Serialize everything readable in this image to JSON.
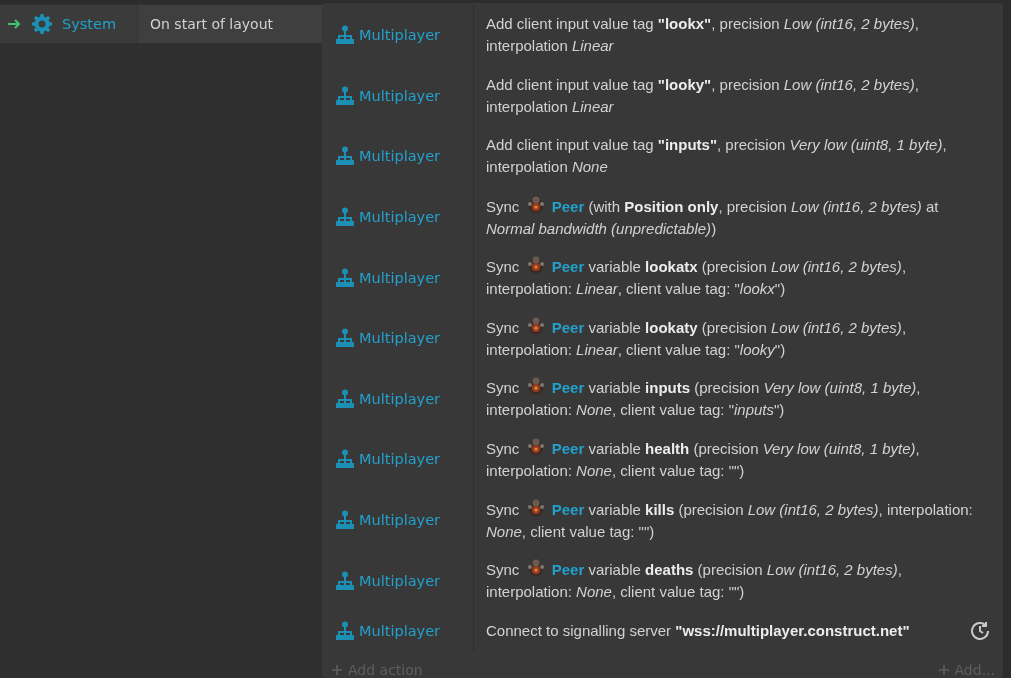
{
  "event": {
    "object": "System",
    "condition": "On start of layout"
  },
  "actions": [
    {
      "kind": "plain",
      "object": "Multiplayer",
      "async": false,
      "text": "Add client input value tag **\"lookx\"**, precision *Low (int16, 2 bytes)*, interpolation *Linear*"
    },
    {
      "kind": "plain",
      "object": "Multiplayer",
      "async": false,
      "text": "Add client input value tag **\"looky\"**, precision *Low (int16, 2 bytes)*, interpolation *Linear*"
    },
    {
      "kind": "plain",
      "object": "Multiplayer",
      "async": false,
      "text": "Add client input value tag **\"inputs\"**, precision *Very low (uint8, 1 byte)*, interpolation *None*"
    },
    {
      "kind": "sync",
      "object": "Multiplayer",
      "async": false,
      "verb": "Sync",
      "target": "Peer",
      "text": "(with **Position only**, precision *Low (int16, 2 bytes)* at *Normal bandwidth (unpredictable)*)"
    },
    {
      "kind": "sync",
      "object": "Multiplayer",
      "async": false,
      "verb": "Sync",
      "target": "Peer",
      "text": "variable **lookatx** (precision *Low (int16, 2 bytes)*, interpolation: *Linear*, client value tag: \"*lookx*\")"
    },
    {
      "kind": "sync",
      "object": "Multiplayer",
      "async": false,
      "verb": "Sync",
      "target": "Peer",
      "text": "variable **lookaty** (precision *Low (int16, 2 bytes)*, interpolation: *Linear*, client value tag: \"*looky*\")"
    },
    {
      "kind": "sync",
      "object": "Multiplayer",
      "async": false,
      "verb": "Sync",
      "target": "Peer",
      "text": "variable **inputs** (precision *Very low (uint8, 1 byte)*, interpolation: *None*, client value tag: \"*inputs*\")"
    },
    {
      "kind": "sync",
      "object": "Multiplayer",
      "async": false,
      "verb": "Sync",
      "target": "Peer",
      "text": "variable **health** (precision *Very low (uint8, 1 byte)*, interpolation: *None*, client value tag: \"\")"
    },
    {
      "kind": "sync",
      "object": "Multiplayer",
      "async": false,
      "verb": "Sync",
      "target": "Peer",
      "text": "variable **kills** (precision *Low (int16, 2 bytes)*, interpolation: *None*, client value tag: \"\")"
    },
    {
      "kind": "sync",
      "object": "Multiplayer",
      "async": false,
      "verb": "Sync",
      "target": "Peer",
      "text": "variable **deaths** (precision *Low (int16, 2 bytes)*, interpolation: *None*, client value tag: \"\")"
    },
    {
      "kind": "plain",
      "object": "Multiplayer",
      "async": true,
      "text": "Connect to signalling server **\"wss://multiplayer.construct.net\"**"
    }
  ],
  "add_action": "Add action",
  "add_more": "Add..."
}
